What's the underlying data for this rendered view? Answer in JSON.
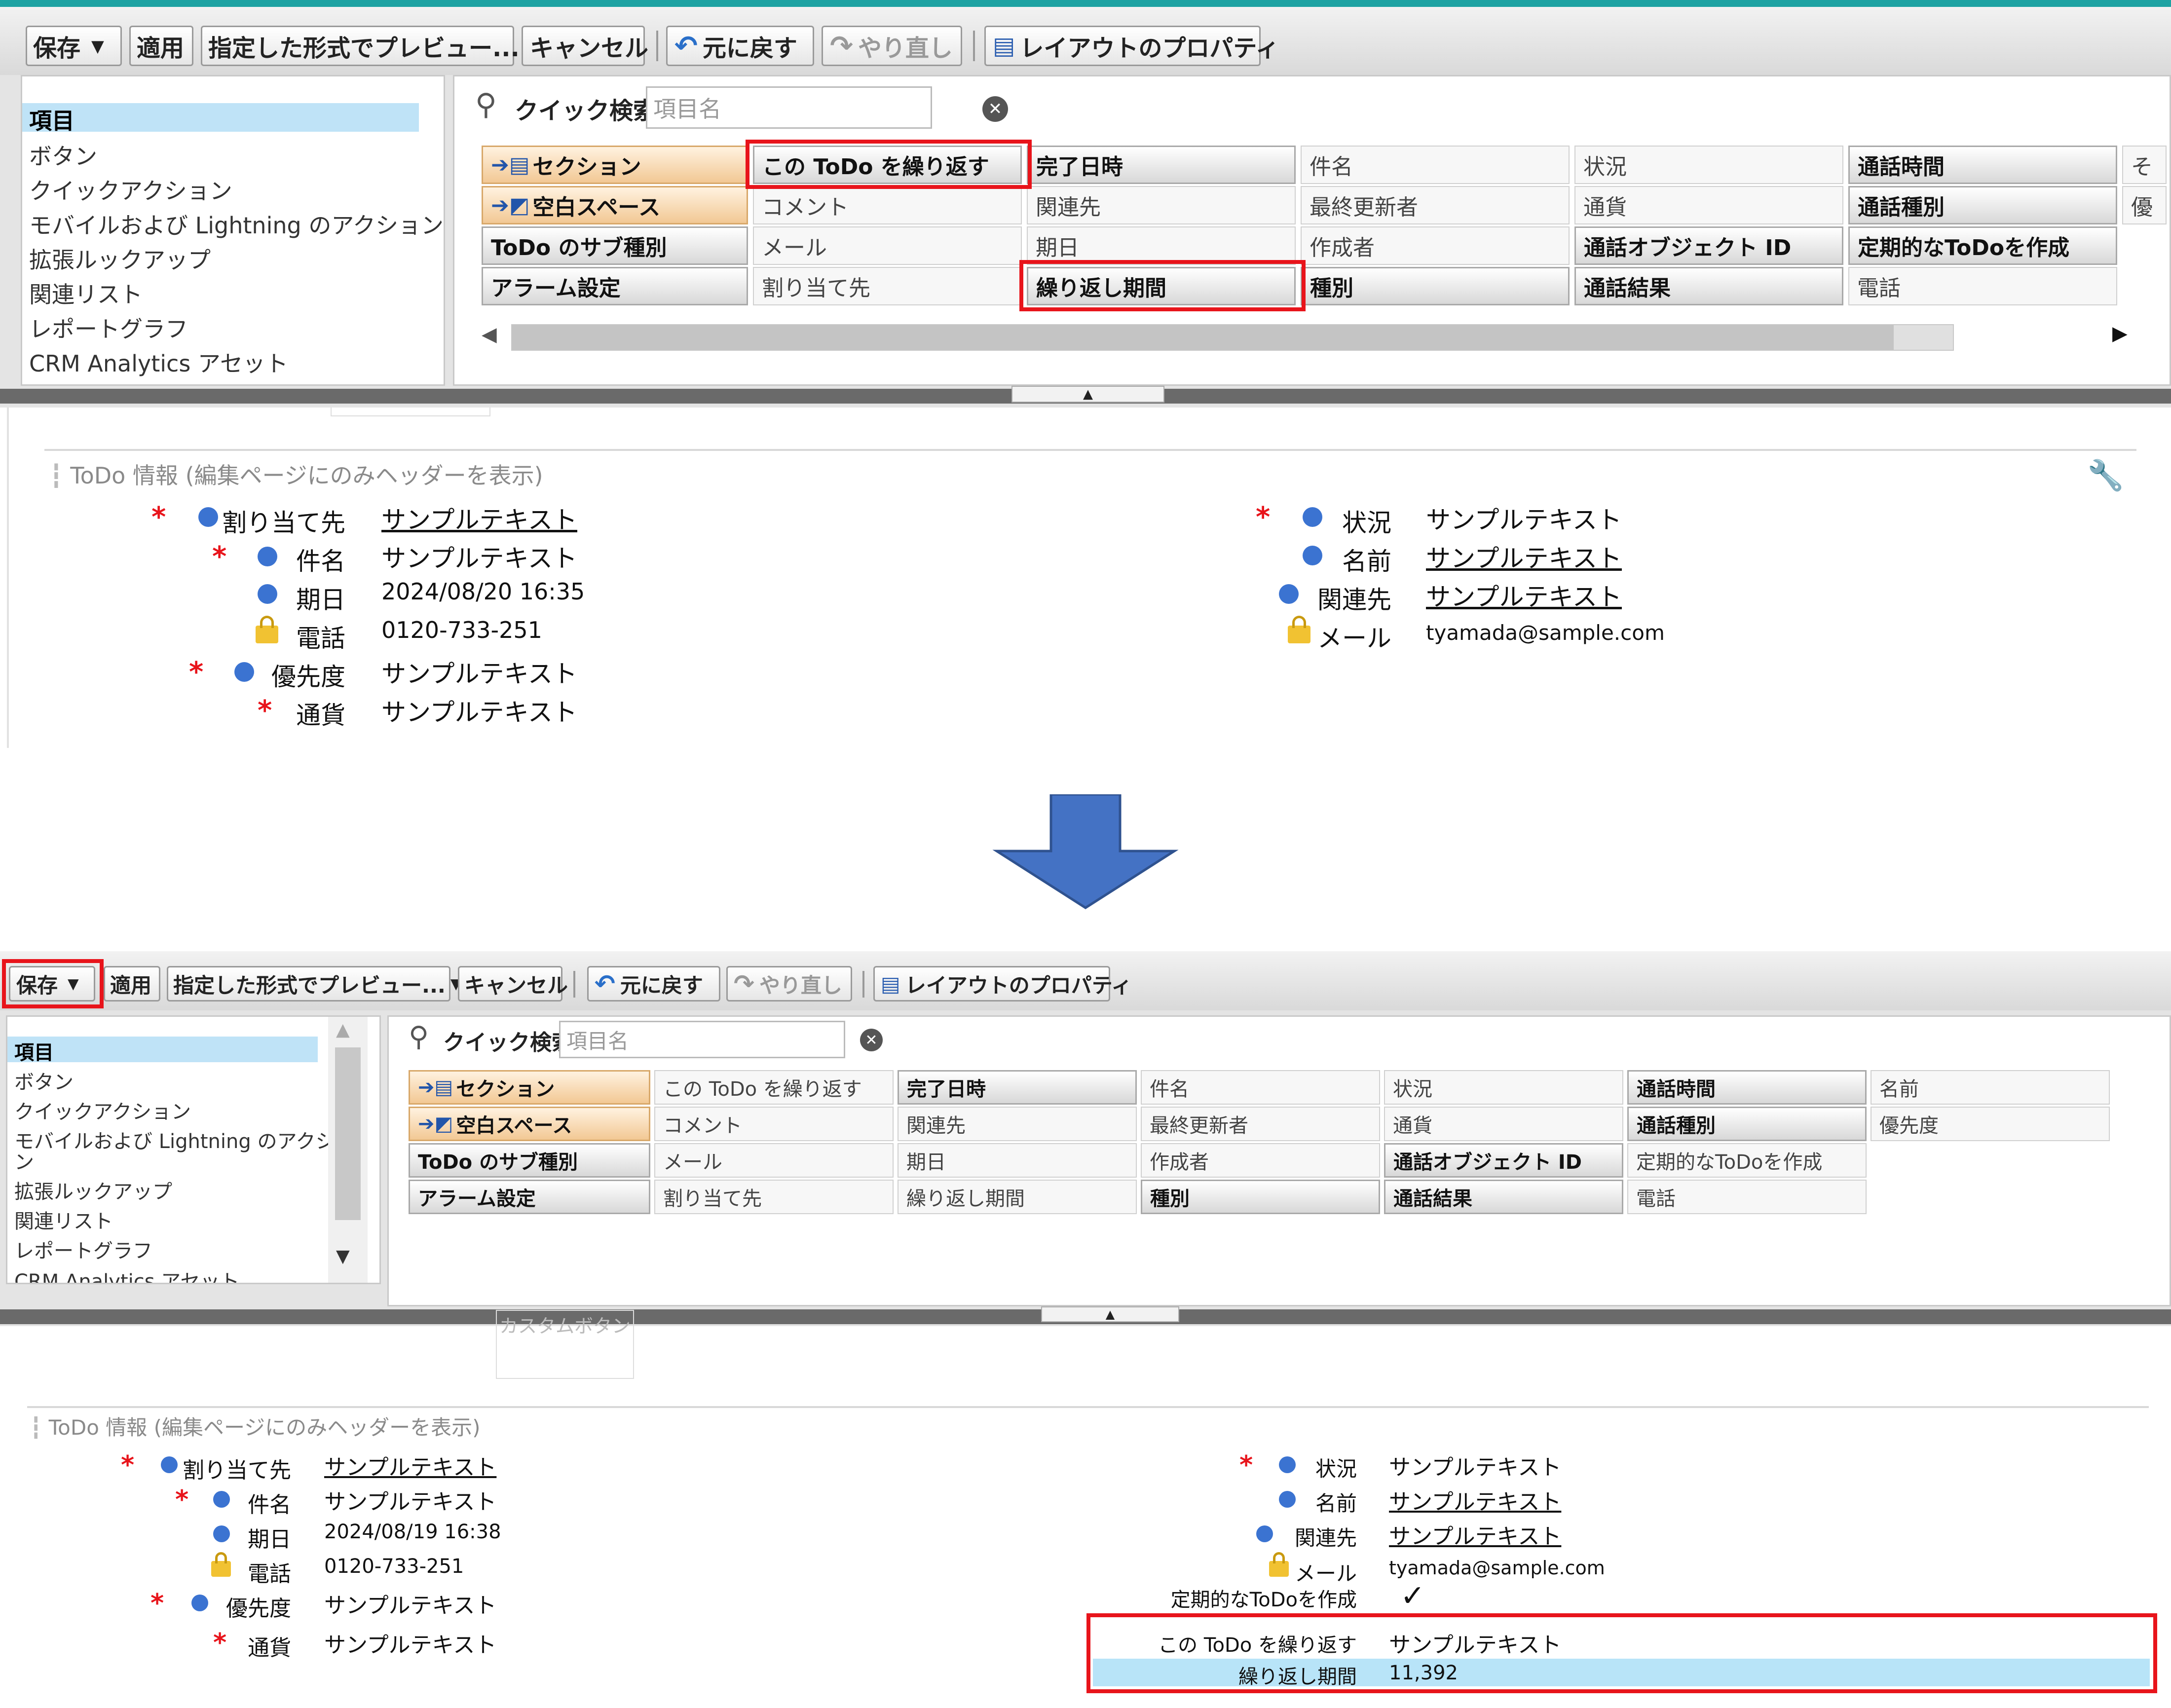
{
  "top": {
    "toolbar": {
      "save": "保存",
      "save_dd": "▼",
      "apply": "適用",
      "preview": "指定した形式でプレビュー...",
      "preview_dd": "▼",
      "cancel": "キャンセル",
      "undo": "元に戻す",
      "redo": "やり直し",
      "layout_props": "レイアウトのプロパティ"
    },
    "categories": [
      "項目",
      "ボタン",
      "クイックアクション",
      "モバイルおよび Lightning のアクション",
      "拡張ルックアップ",
      "関連リスト",
      "レポートグラフ",
      "CRM Analytics アセット"
    ],
    "quick_search": {
      "label": "クイック検索",
      "placeholder": "項目名"
    },
    "grid": [
      [
        "セクション",
        "この ToDo を繰り返す",
        "完了日時",
        "件名",
        "状況",
        "通話時間",
        "そ"
      ],
      [
        "空白スペース",
        "コメント",
        "関連先",
        "最終更新者",
        "通貨",
        "通話種別",
        "優"
      ],
      [
        "ToDo のサブ種別",
        "メール",
        "期日",
        "作成者",
        "通話オブジェクト ID",
        "定期的なToDoを作成"
      ],
      [
        "アラーム設定",
        "割り当て先",
        "繰り返し期間",
        "種別",
        "通話結果",
        "電話"
      ]
    ],
    "section_title": "ToDo 情報 (編集ページにのみヘッダーを表示)",
    "left_fields": [
      {
        "label": "割り当て先",
        "value": "サンプルテキスト"
      },
      {
        "label": "件名",
        "value": "サンプルテキスト"
      },
      {
        "label": "期日",
        "value": "2024/08/20 16:35"
      },
      {
        "label": "電話",
        "value": "0120-733-251"
      },
      {
        "label": "優先度",
        "value": "サンプルテキスト"
      },
      {
        "label": "通貨",
        "value": "サンプルテキスト"
      }
    ],
    "right_fields": [
      {
        "label": "状況",
        "value": "サンプルテキスト"
      },
      {
        "label": "名前",
        "value": "サンプルテキスト"
      },
      {
        "label": "関連先",
        "value": "サンプルテキスト"
      },
      {
        "label": "メール",
        "value": "tyamada@sample.com"
      }
    ]
  },
  "bottom": {
    "toolbar": {
      "save": "保存",
      "save_dd": "▼",
      "apply": "適用",
      "preview": "指定した形式でプレビュー...",
      "preview_dd": "▼",
      "cancel": "キャンセル",
      "undo": "元に戻す",
      "redo": "やり直し",
      "layout_props": "レイアウトのプロパティ"
    },
    "categories": [
      "項目",
      "ボタン",
      "クイックアクション",
      "モバイルおよび Lightning のアクショ",
      "ン",
      "拡張ルックアップ",
      "関連リスト",
      "レポートグラフ",
      "CRM Analytics アセット"
    ],
    "quick_search": {
      "label": "クイック検索",
      "placeholder": "項目名"
    },
    "grid": [
      [
        "セクション",
        "この ToDo を繰り返す",
        "完了日時",
        "件名",
        "状況",
        "通話時間",
        "名前"
      ],
      [
        "空白スペース",
        "コメント",
        "関連先",
        "最終更新者",
        "通貨",
        "通話種別",
        "優先度"
      ],
      [
        "ToDo のサブ種別",
        "メール",
        "期日",
        "作成者",
        "通話オブジェクト ID",
        "定期的なToDoを作成"
      ],
      [
        "アラーム設定",
        "割り当て先",
        "繰り返し期間",
        "種別",
        "通話結果",
        "電話"
      ]
    ],
    "custom_button_label": "カスタムボタン",
    "section_title": "ToDo 情報 (編集ページにのみヘッダーを表示)",
    "left_fields": [
      {
        "label": "割り当て先",
        "value": "サンプルテキスト"
      },
      {
        "label": "件名",
        "value": "サンプルテキスト"
      },
      {
        "label": "期日",
        "value": "2024/08/19 16:38"
      },
      {
        "label": "電話",
        "value": "0120-733-251"
      },
      {
        "label": "優先度",
        "value": "サンプルテキスト"
      },
      {
        "label": "通貨",
        "value": "サンプルテキスト"
      }
    ],
    "right_fields": [
      {
        "label": "状況",
        "value": "サンプルテキスト"
      },
      {
        "label": "名前",
        "value": "サンプルテキスト"
      },
      {
        "label": "関連先",
        "value": "サンプルテキスト"
      },
      {
        "label": "メール",
        "value": "tyamada@sample.com"
      },
      {
        "label": "定期的なToDoを作成",
        "value": "✓"
      },
      {
        "label": "この ToDo を繰り返す",
        "value": "サンプルテキスト"
      },
      {
        "label": "繰り返し期間",
        "value": "11,392"
      }
    ]
  },
  "colors": {
    "highlight": "#e8141b",
    "accent_arrow": "#4472c4",
    "required": "#e8141b",
    "dot": "#3b73d1",
    "selected_row": "#b8e4f8"
  },
  "icons": {
    "search": "magnifier-icon",
    "clear": "clear-icon",
    "undo": "undo-icon",
    "redo": "redo-icon",
    "layout": "layout-properties-icon",
    "wrench": "wrench-icon",
    "lock": "lock-icon",
    "arrow": "down-arrow-icon"
  }
}
